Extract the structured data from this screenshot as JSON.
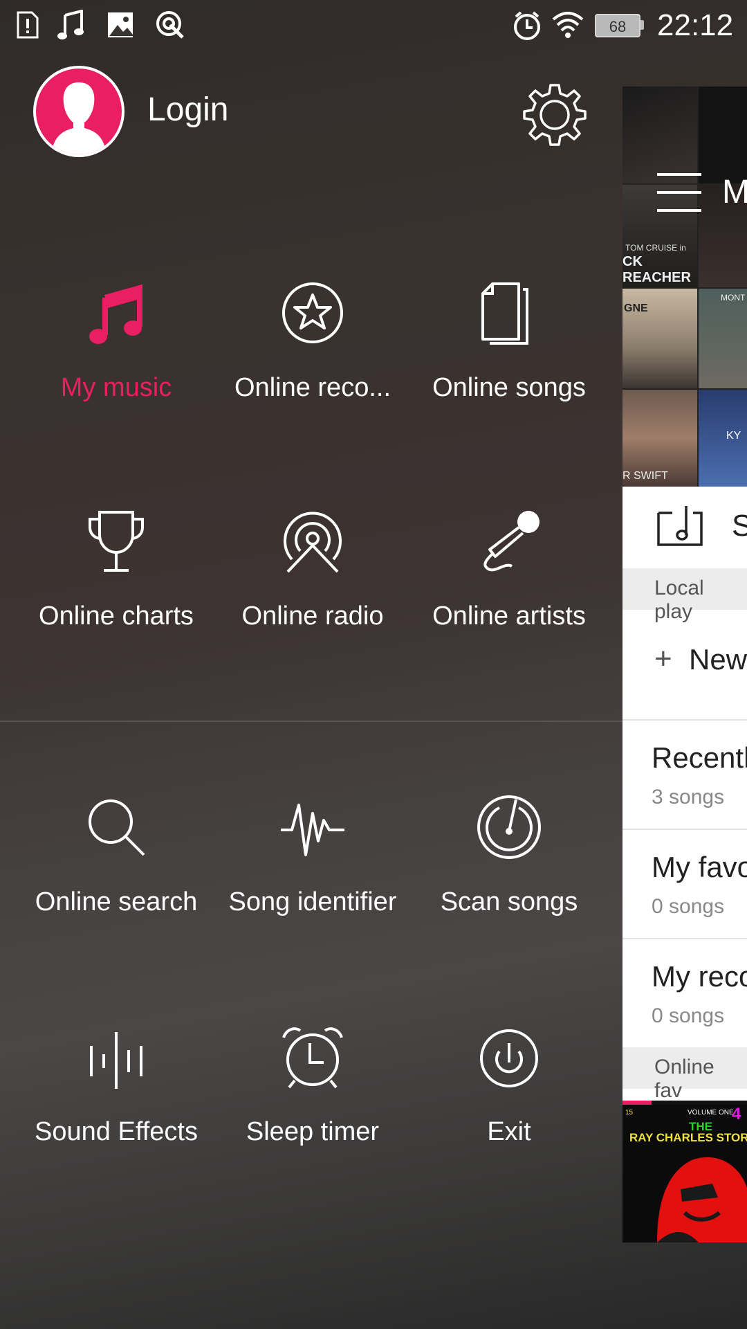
{
  "status_bar": {
    "icons": [
      "alert-sim-icon",
      "music-note-icon",
      "image-icon",
      "sync-icon",
      "alarm-icon",
      "wifi-icon"
    ],
    "battery": "68",
    "time": "22:12"
  },
  "header": {
    "login_label": "Login",
    "settings_icon": "gear-icon"
  },
  "menu": {
    "items": [
      {
        "label": "My music",
        "icon": "music-note-icon",
        "active": true
      },
      {
        "label": "Online reco...",
        "icon": "star-circle-icon"
      },
      {
        "label": "Online songs",
        "icon": "documents-icon"
      },
      {
        "label": "Online charts",
        "icon": "trophy-icon"
      },
      {
        "label": "Online radio",
        "icon": "radio-broadcast-icon"
      },
      {
        "label": "Online artists",
        "icon": "microphone-icon"
      },
      {
        "label": "Online search",
        "icon": "search-icon"
      },
      {
        "label": "Song identifier",
        "icon": "waveform-icon"
      },
      {
        "label": "Scan songs",
        "icon": "radar-scan-icon"
      },
      {
        "label": "Sound Effects",
        "icon": "equalizer-icon"
      },
      {
        "label": "Sleep timer",
        "icon": "alarm-clock-icon"
      },
      {
        "label": "Exit",
        "icon": "power-icon"
      }
    ]
  },
  "peek": {
    "title_fragment": "M",
    "row_icon_label": "S",
    "local_section": "Local play",
    "new_label": "New",
    "playlists": [
      {
        "title": "Recentl",
        "count": "3 songs"
      },
      {
        "title": "My favo",
        "count": "0 songs"
      },
      {
        "title": "My reco",
        "count": "0 songs"
      }
    ],
    "online_section": "Online fav",
    "cover_text_1": "TOM CRUISE in",
    "cover_text_2": "CK REACHER",
    "cover_text_3": "R SWIFT",
    "cover_text_4": "KY",
    "cover_text_5": "MONT",
    "cover_text_6": "GNE",
    "mini_player_title_1": "THE",
    "mini_player_title_2": "RAY CHARLES STORY",
    "mini_player_top": "VOLUME ONE",
    "mini_player_num": "4"
  },
  "colors": {
    "accent": "#e91e63",
    "drawer_bg": "#3a3433",
    "text": "#ffffff"
  }
}
